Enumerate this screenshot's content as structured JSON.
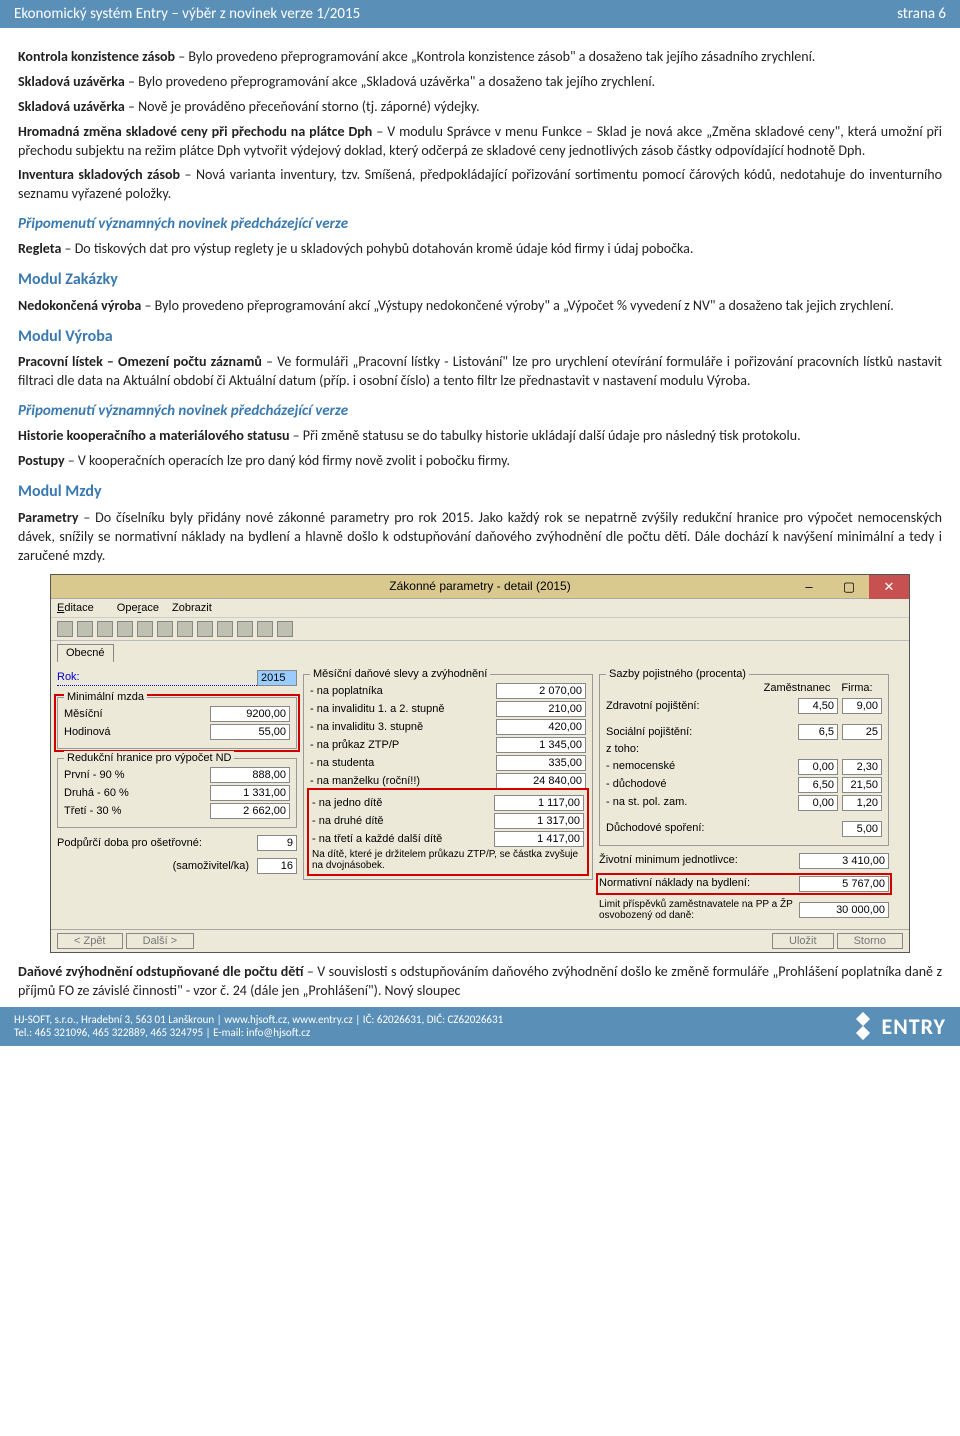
{
  "header": {
    "left": "Ekonomický systém Entry – výběr z novinek verze 1/2015",
    "right": "strana 6"
  },
  "body": {
    "p1_b": "Kontrola konzistence zásob",
    "p1_r": " – Bylo provedeno přeprogramování akce „Kontrola konzistence zásob\" a dosaženo tak jejího zásadního zrychlení.",
    "p2_b": "Skladová uzávěrka",
    "p2_r": " – Bylo provedeno přeprogramování akce „Skladová uzávěrka\" a dosaženo tak jejího zrychlení.",
    "p3_b": "Skladová uzávěrka",
    "p3_r": " – Nově je prováděno přeceňování storno (tj. záporné) výdejky.",
    "p4_b": "Hromadná změna skladové ceny při přechodu na plátce Dph",
    "p4_r": " – V modulu Správce v menu Funkce – Sklad je nová akce „Změna skladové ceny\", která umožní při přechodu subjektu na režim plátce Dph vytvořit výdejový doklad, který odčerpá ze skladové ceny jednotlivých zásob částky odpovídající hodnotě Dph.",
    "p5_b": "Inventura skladových zásob",
    "p5_r": " – Nová varianta inventury, tzv. Smíšená, předpokládající pořizování sortimentu pomocí čárových kódů, nedotahuje do inventurního seznamu vyřazené položky.",
    "sub1": "Připomenutí významných novinek předcházející verze",
    "p6_b": "Regleta",
    "p6_r": " – Do tiskových dat pro výstup reglety je u skladových pohybů dotahován kromě údaje kód firmy i údaj pobočka.",
    "mod1": "Modul Zakázky",
    "p7_b": "Nedokončená výroba",
    "p7_r": " – Bylo provedeno přeprogramování akcí „Výstupy nedokončené výroby\" a „Výpočet % vyvedení z NV\" a dosaženo tak jejich zrychlení.",
    "mod2": "Modul Výroba",
    "p8_b": "Pracovní lístek – Omezení počtu záznamů",
    "p8_r": " – Ve formuláři „Pracovní lístky - Listování\" lze pro urychlení otevírání formuláře i pořizování pracovních lístků nastavit filtraci dle data na Aktuální období či Aktuální datum (příp. i osobní číslo) a tento filtr lze přednastavit v nastavení modulu Výroba.",
    "sub2": "Připomenutí významných novinek předcházející verze",
    "p9_b": "Historie kooperačního a materiálového statusu",
    "p9_r": " – Při změně statusu se do tabulky historie ukládají další údaje pro následný tisk protokolu.",
    "p10_b": "Postupy",
    "p10_r": " – V kooperačních operacích lze pro daný kód firmy nově zvolit i pobočku firmy.",
    "mod3": "Modul Mzdy",
    "p11_b": "Parametry",
    "p11_r": " – Do číselníku byly přidány nové zákonné parametry pro rok 2015. Jako každý rok se nepatrně zvýšily redukční hranice pro výpočet nemocenských dávek, snížily se normativní náklady na bydlení a hlavně došlo k odstupňování daňového zvýhodnění dle počtu dětí. Dále dochází k navýšení minimální a tedy i zaručené mzdy.",
    "p12_b": "Daňové zvýhodnění odstupňované dle počtu dětí",
    "p12_r": " – V souvislosti s odstupňováním daňového zvýhodnění došlo ke změně formuláře „Prohlášení poplatníka daně z příjmů FO ze závislé činnosti\" - vzor č. 24 (dále jen „Prohlášení\"). Nový sloupec"
  },
  "win": {
    "title": "Zákonné parametry - detail (2015)",
    "menu": {
      "editace": "Editace",
      "operace": "Operace",
      "zobrazit": "Zobrazit"
    },
    "tab": "Obecné",
    "rok_label": "Rok:",
    "rok_value": "2015",
    "min_mzda_group": "Minimální mzda",
    "mesicni": "Měsíční",
    "mesicni_v": "9200,00",
    "hodinova": "Hodinová",
    "hodinova_v": "55,00",
    "reduk_group": "Redukční hranice pro výpočet ND",
    "prvni": "První - 90 %",
    "prvni_v": "888,00",
    "druha": "Druhá - 60 %",
    "druha_v": "1 331,00",
    "treti": "Třetí - 30 %",
    "treti_v": "2 662,00",
    "podpurci": "Podpůrčí doba pro ošetřovné:",
    "podpurci_v": "9",
    "samoziv": "(samoživitel/ka)",
    "samoziv_v": "16",
    "slevy_group": "Měsíční daňové slevy a zvýhodnění",
    "na_pop": "- na poplatníka",
    "na_pop_v": "2 070,00",
    "na_inv12": "- na invaliditu 1. a 2. stupně",
    "na_inv12_v": "210,00",
    "na_inv3": "- na invaliditu 3. stupně",
    "na_inv3_v": "420,00",
    "na_ztp": "- na průkaz ZTP/P",
    "na_ztp_v": "1 345,00",
    "na_stud": "- na studenta",
    "na_stud_v": "335,00",
    "na_manz": "- na manželku (roční!!)",
    "na_manz_v": "24 840,00",
    "na_d1": "- na jedno dítě",
    "na_d1_v": "1 117,00",
    "na_d2": "- na druhé dítě",
    "na_d2_v": "1 317,00",
    "na_d3": "- na třetí a každé další dítě",
    "na_d3_v": "1 417,00",
    "ztp_note": "Na dítě, které je držitelem průkazu ZTP/P, se částka zvyšuje na dvojnásobek.",
    "sazby_group": "Sazby pojistného (procenta)",
    "col_zam": "Zaměstnanec",
    "col_firma": "Firma:",
    "zdrav": "Zdravotní pojištění:",
    "zdrav_z": "4,50",
    "zdrav_f": "9,00",
    "soc": "Sociální pojištění:",
    "soc_z": "6,5",
    "soc_f": "25",
    "ztoho": "z toho:",
    "nemoc": "- nemocenské",
    "nemoc_z": "0,00",
    "nemoc_f": "2,30",
    "duch": "- důchodové",
    "duch_z": "6,50",
    "duch_f": "21,50",
    "stpol": "- na st. pol. zam.",
    "stpol_z": "0,00",
    "stpol_f": "1,20",
    "duchspor": "Důchodové spoření:",
    "duchspor_v": "5,00",
    "zivmin": "Životní minimum jednotlivce:",
    "zivmin_v": "3 410,00",
    "normnakl": "Normativní náklady na bydlení:",
    "normnakl_v": "5 767,00",
    "limitpp": "Limit příspěvků zaměstnavatele na PP a ŽP osvobozený od daně:",
    "limitpp_v": "30 000,00",
    "btn_zpet": "< Zpět",
    "btn_dalsi": "Další >",
    "btn_ulozit": "Uložit",
    "btn_storno": "Storno"
  },
  "footer": {
    "line1": "HJ-SOFT, s.r.o., Hradební 3, 563 01 Lanškroun | www.hjsoft.cz, www.entry.cz | IČ: 62026631, DIČ: CZ62026631",
    "line2": "Tel.: 465 321096, 465 322889, 465 324795 | E-mail: info@hjsoft.cz",
    "logo": "ENTRY"
  }
}
